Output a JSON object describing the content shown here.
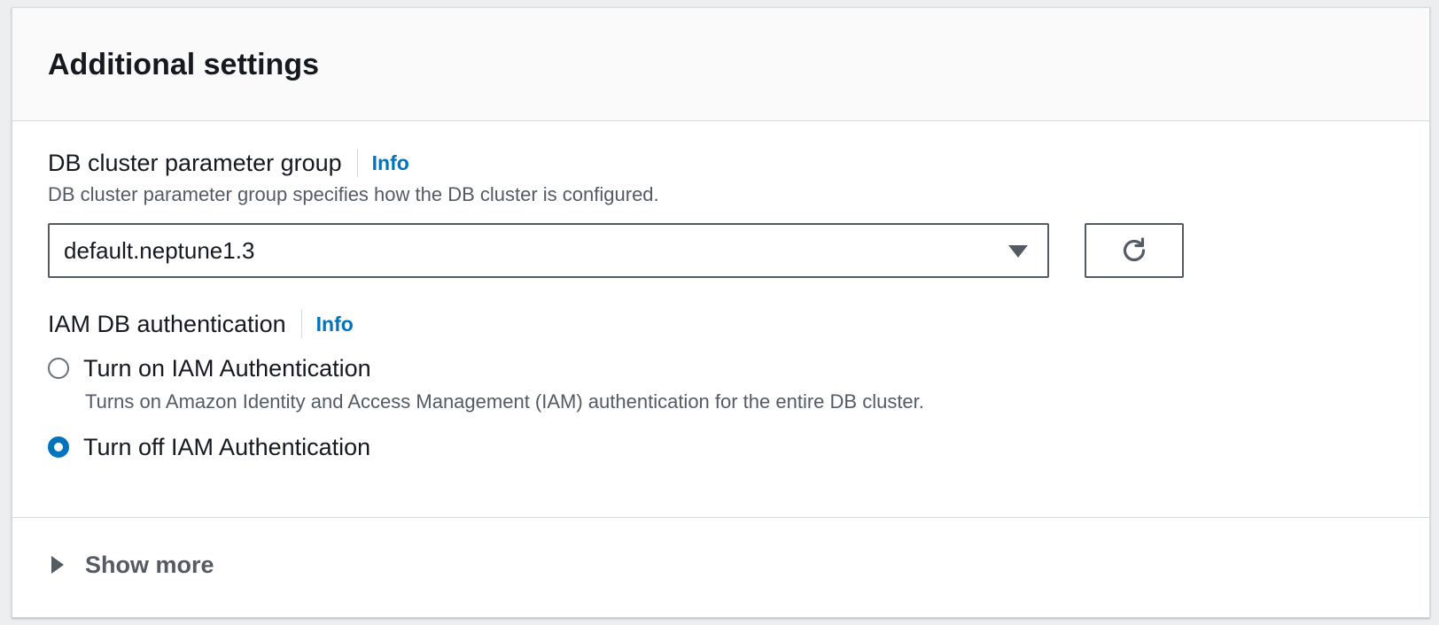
{
  "panel": {
    "title": "Additional settings"
  },
  "param_group": {
    "label": "DB cluster parameter group",
    "info": "Info",
    "description": "DB cluster parameter group specifies how the DB cluster is configured.",
    "selected_value": "default.neptune1.3"
  },
  "iam_auth": {
    "label": "IAM DB authentication",
    "info": "Info",
    "options": [
      {
        "label": "Turn on IAM Authentication",
        "description": "Turns on Amazon Identity and Access Management (IAM) authentication for the entire DB cluster.",
        "selected": false
      },
      {
        "label": "Turn off IAM Authentication",
        "description": "",
        "selected": true
      }
    ]
  },
  "footer": {
    "expander_label": "Show more"
  },
  "icons": {
    "refresh": "refresh-icon",
    "dropdown": "caret-down-icon",
    "expand": "caret-right-icon"
  },
  "colors": {
    "accent": "#0073bb",
    "text": "#16191f",
    "secondary_text": "#545b64",
    "border": "#d5dbdb"
  }
}
